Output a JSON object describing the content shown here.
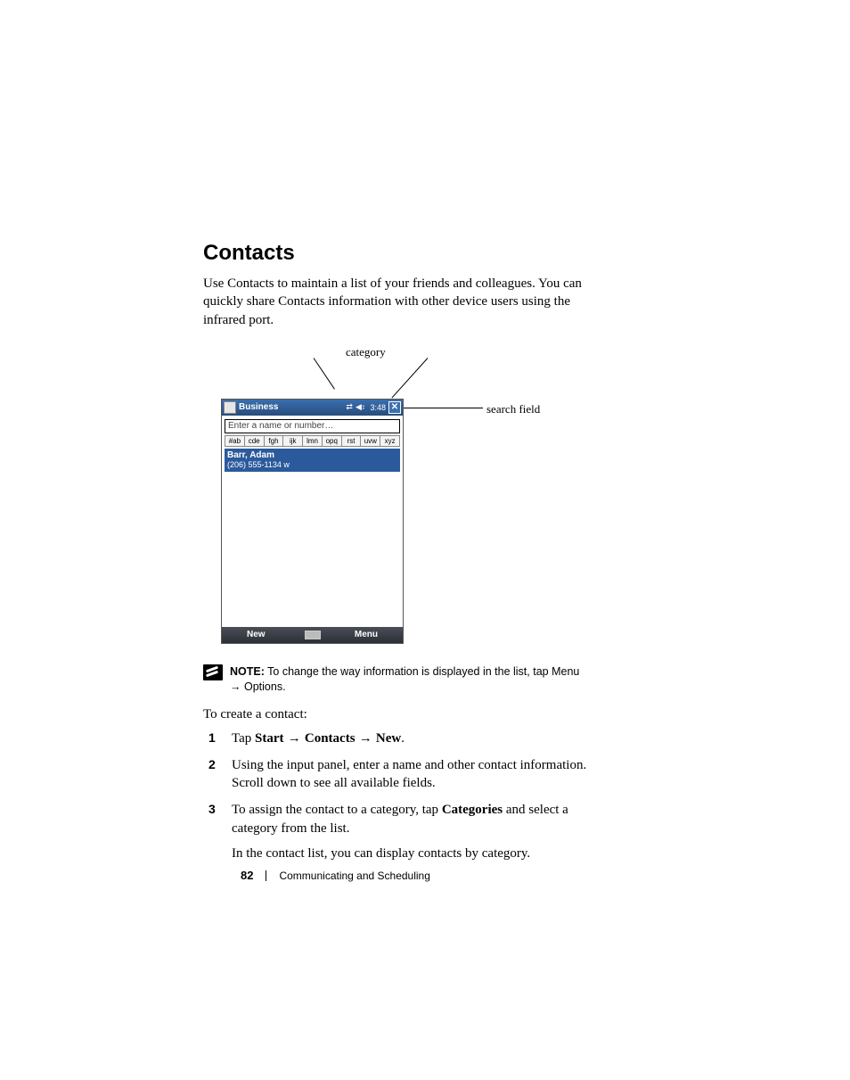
{
  "heading": "Contacts",
  "intro": "Use Contacts to maintain a list of your friends and colleagues. You can quickly share Contacts information with other device users using the infrared port.",
  "callouts": {
    "category": "category",
    "search_field": "search field"
  },
  "device": {
    "title": "Business",
    "time": "3:48",
    "search_placeholder": "Enter a name or number…",
    "alpha_tabs": [
      "#ab",
      "cde",
      "fgh",
      "ijk",
      "lmn",
      "opq",
      "rst",
      "uvw",
      "xyz"
    ],
    "selected_contact": {
      "name": "Barr, Adam",
      "phone": "(206) 555-1134   w"
    },
    "softkeys": {
      "left": "New",
      "right": "Menu"
    }
  },
  "note": {
    "label": "NOTE:",
    "text_part1": " To change the way information is displayed in the list, tap ",
    "menu": "Menu",
    "arrow": " → ",
    "options": "Options",
    "period": "."
  },
  "create_label": "To create a contact:",
  "steps": {
    "s1": {
      "prefix": "Tap ",
      "a": "Start",
      "arr1": " → ",
      "b": "Contacts",
      "arr2": " → ",
      "c": "New",
      "suffix": "."
    },
    "s2": "Using the input panel, enter a name and other contact information. Scroll down to see all available fields.",
    "s3": {
      "part1": "To assign the contact to a category, tap ",
      "bold": "Categories",
      "part2": " and select a category from the list.",
      "sub": "In the contact list, you can display contacts by category."
    }
  },
  "footer": {
    "page": "82",
    "section": "Communicating and Scheduling"
  }
}
